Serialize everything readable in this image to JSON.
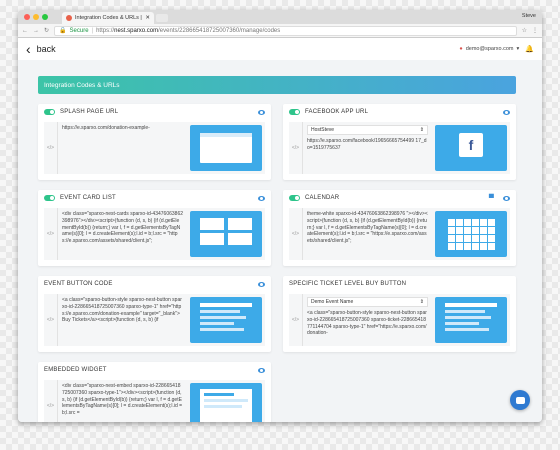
{
  "browser": {
    "tab_title": "Integration Codes & URLs | Sp",
    "user_name": "Steve",
    "secure_label": "Secure",
    "url_scheme": "https://",
    "url_host": "nest.sparxo.com",
    "url_path": "/events/2286654187250073​60/manage/codes",
    "traffic_colors": [
      "#fc5f57",
      "#fdbc2e",
      "#28c840"
    ]
  },
  "topbar": {
    "back_label": "back",
    "account_email": "demo@sparxo.com"
  },
  "section_title": "Integration Codes & URLs",
  "cards": [
    {
      "title": "SPLASH PAGE URL",
      "toggle": true,
      "code": "https://e.sparxo.com/donation-example-",
      "preview": "browser"
    },
    {
      "title": "FACEBOOK APP URL",
      "toggle": true,
      "select_value": "HostSteve",
      "code": "https://e.sparxo.com/facebook/19656665754499 17_do=1519775637",
      "preview": "facebook"
    },
    {
      "title": "EVENT CARD LIST",
      "toggle": true,
      "code": "<div class=\"sparxo-nest-cards sparxo-id-43476063862398976\"></div><script>(function (d, s, b) {if (d.getElementById(b)) {return;} var l, f = d.getElementsByTagName(s)[0]; l = d.createElement(s);l.id = b;l.src = \"https://e.sparxo.com/assets/shared/client.js\";",
      "preview": "cards"
    },
    {
      "title": "CALENDAR",
      "toggle": true,
      "code": "theme-white sparxo-id-43476063862398976 \"></div><script>(function (d, s, b) {if (d.getElementById(b)) {return;} var l, f = d.getElementsByTagName(s)[0]; l = d.createElement(s);l.id = b;l.src = \"https://e.sparxo.com/assets/shared/client.js\";",
      "preview": "calendar"
    },
    {
      "title": "EVENT BUTTON CODE",
      "toggle": false,
      "code": "<a class=\"sparxo-button-style sparxo-nest-button sparxo-id-228665418725007360 sparxo-type-1\" href=\"https://e.sparxo.com/donation-example\" target=\"_blank\">Buy Tickets</a><script>(function (d, s, b) {if",
      "preview": "list"
    },
    {
      "title": "SPECIFIC TICKET LEVEL BUY BUTTON",
      "toggle": false,
      "select_value": "Demo Event Name",
      "code": "<a class=\"sparxo-button-style sparxo-nest-button sparxo-id-228665418725007360 sparxo-ticket-228665418771144704 sparxo-type-1\" href=\"https://e.sparxo.com/donation-",
      "preview": "list"
    },
    {
      "title": "EMBEDDED WIDGET",
      "toggle": false,
      "code": "<div class=\"sparxo-nest-embed sparxo-id-228665418725007360 sparxo-type-1\"></div><script>(function (d, s, b) {if (d.getElementById(b)) {return;} var l, f = d.getElementsByTagName(s)[0]; l = d.createElement(s);l.id = b;l.src =",
      "preview": "widget"
    }
  ],
  "colors": {
    "accent": "#3daae8",
    "toggle_on": "#2ec48b",
    "gradient_start": "#3cc4a7",
    "gradient_end": "#4aa3df"
  }
}
